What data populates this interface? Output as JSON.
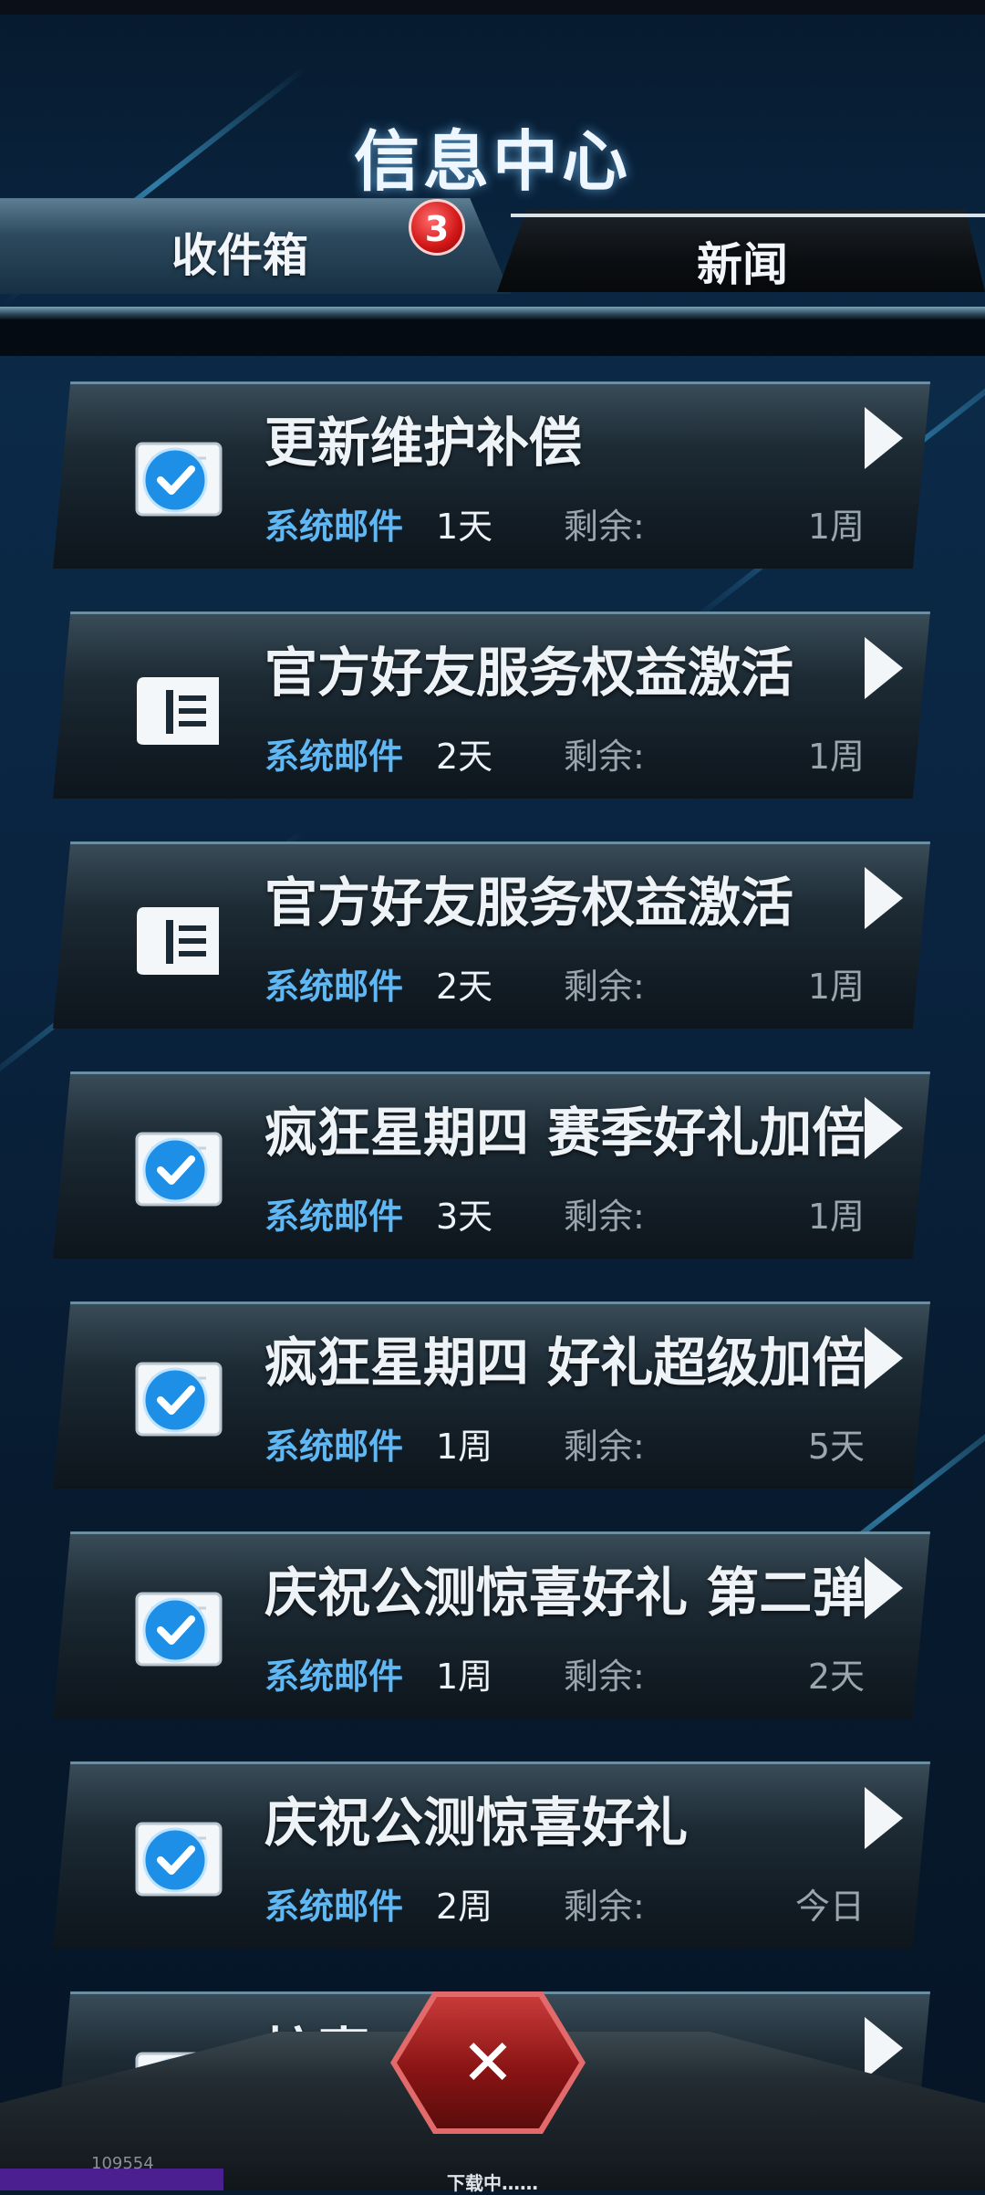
{
  "header": {
    "title": "信息中心"
  },
  "tabs": [
    {
      "label": "收件箱",
      "badge": "3",
      "active": true
    },
    {
      "label": "新闻",
      "active": false
    }
  ],
  "remaining_label": "剩余:",
  "mails": [
    {
      "title": "更新维护补偿",
      "sender": "系统邮件",
      "age": "1天",
      "remaining": "1周",
      "icon": "check-badge-icon"
    },
    {
      "title": "官方好友服务权益激活",
      "sender": "系统邮件",
      "age": "2天",
      "remaining": "1周",
      "icon": "letter-icon"
    },
    {
      "title": "官方好友服务权益激活",
      "sender": "系统邮件",
      "age": "2天",
      "remaining": "1周",
      "icon": "letter-icon"
    },
    {
      "title": "疯狂星期四 赛季好礼加倍",
      "sender": "系统邮件",
      "age": "3天",
      "remaining": "1周",
      "icon": "check-badge-icon"
    },
    {
      "title": "疯狂星期四 好礼超级加倍",
      "sender": "系统邮件",
      "age": "1周",
      "remaining": "5天",
      "icon": "check-badge-icon"
    },
    {
      "title": "庆祝公测惊喜好礼 第二弹",
      "sender": "系统邮件",
      "age": "1周",
      "remaining": "2天",
      "icon": "check-badge-icon"
    },
    {
      "title": "庆祝公测惊喜好礼",
      "sender": "系统邮件",
      "age": "2周",
      "remaining": "今日",
      "icon": "check-badge-icon"
    },
    {
      "title": "惊喜…放送",
      "sender": "",
      "age": "",
      "remaining": "",
      "icon": "check-badge-icon"
    }
  ],
  "close_button": {
    "label": "✕"
  },
  "footer": {
    "id": "109554",
    "status": "下载中……"
  },
  "colors": {
    "accent": "#5fb7f4",
    "badge": "#d11616",
    "close": "#8a1414"
  }
}
